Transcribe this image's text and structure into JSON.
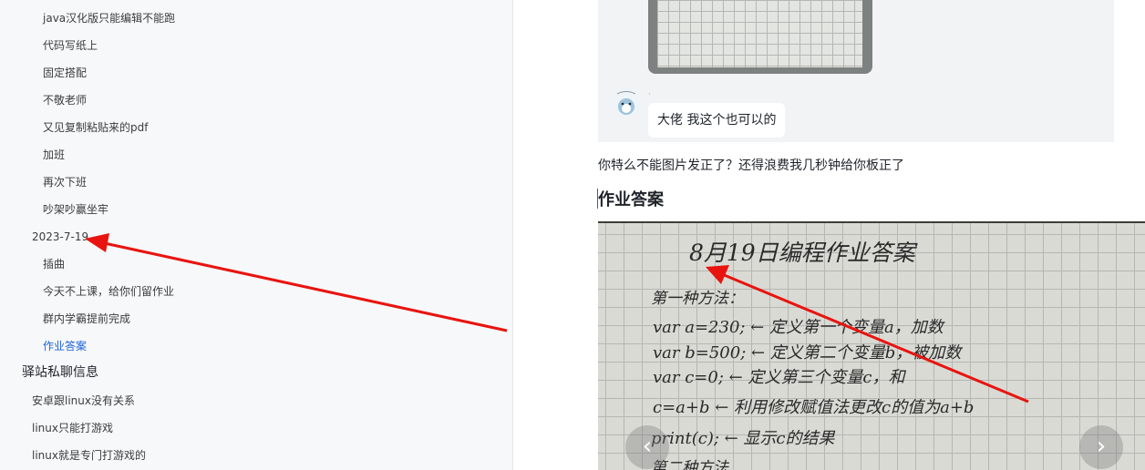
{
  "sidebar": {
    "items": [
      {
        "label": "java汉化版只能编辑不能跑",
        "level": 3
      },
      {
        "label": "代码写纸上",
        "level": 3
      },
      {
        "label": "固定搭配",
        "level": 3
      },
      {
        "label": "不敬老师",
        "level": 3
      },
      {
        "label": "又见复制粘贴来的pdf",
        "level": 3
      },
      {
        "label": "加班",
        "level": 3
      },
      {
        "label": "再次下班",
        "level": 3
      },
      {
        "label": "吵架吵赢坐牢",
        "level": 3
      },
      {
        "label": "2023-7-19",
        "level": 2
      },
      {
        "label": "插曲",
        "level": 3
      },
      {
        "label": "今天不上课，给你们留作业",
        "level": 3
      },
      {
        "label": "群内学霸提前完成",
        "level": 3
      },
      {
        "label": "作业答案",
        "level": 3,
        "active": true
      },
      {
        "label": "驿站私聊信息",
        "level": 1
      },
      {
        "label": "安卓跟linux没有关系",
        "level": 2
      },
      {
        "label": "linux只能打游戏",
        "level": 2
      },
      {
        "label": "linux就是专门打游戏的",
        "level": 2
      }
    ]
  },
  "content": {
    "chat": {
      "sender_name": "·",
      "message": "大佬 我这个也可以的"
    },
    "paragraph": "你特么不能图片发正了？还得浪费我几秒钟给你板正了",
    "heading": "作业答案",
    "photo": {
      "title": "8月19日编程作业答案",
      "lines": [
        "第一种方法：",
        "var a=230; ← 定义第一个变量a，加数",
        "var b=500; ← 定义第二个变量b，被加数",
        "var c=0; ← 定义第三个变量c，和",
        "c=a+b ← 利用修改赋值法更改c的值为a+b",
        "print(c); ← 显示c的结果",
        "第二种方法"
      ],
      "prev_icon": "chevron-left-icon",
      "next_icon": "chevron-right-icon"
    }
  },
  "colors": {
    "arrow": "#e8140f",
    "active_link": "#1d63d8",
    "sidebar_bg": "#f7f8fa"
  }
}
